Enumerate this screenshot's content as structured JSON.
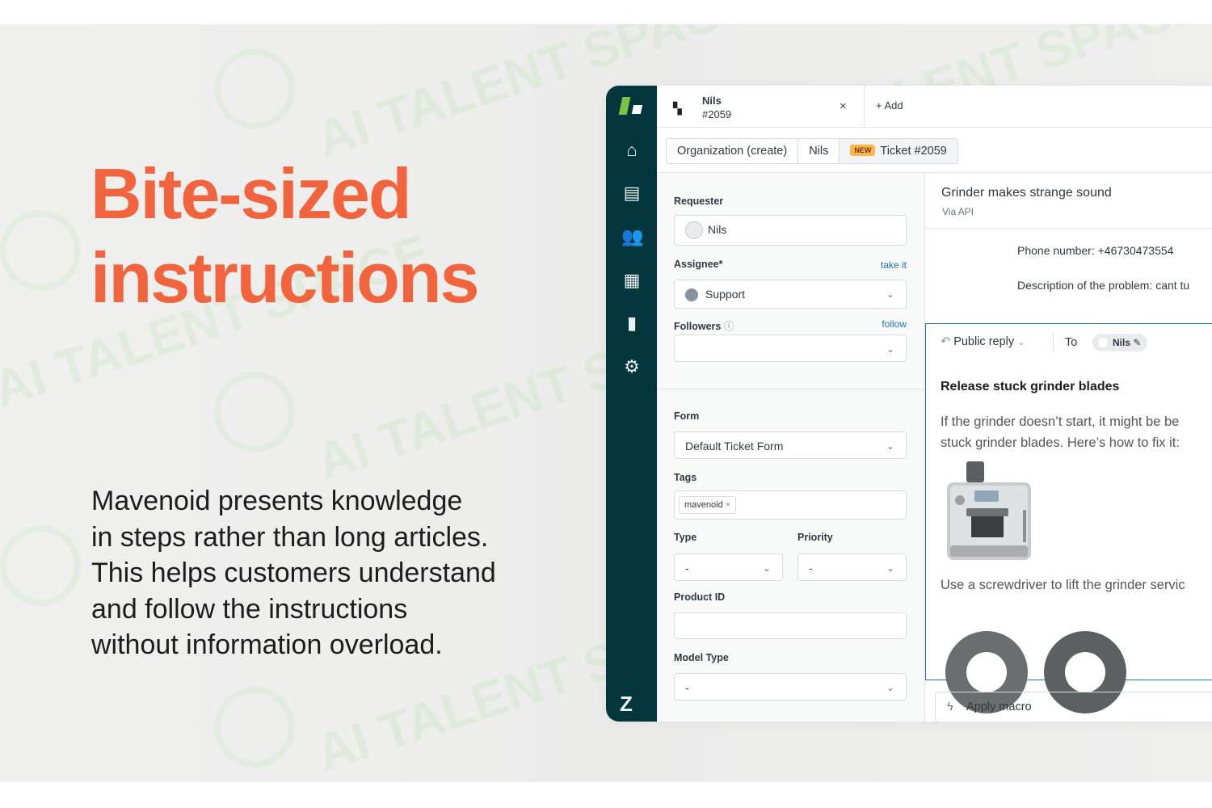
{
  "marketing": {
    "headline_line1": "Bite-sized",
    "headline_line2": "instructions",
    "body_lines": [
      "Mavenoid presents knowledge",
      "in steps rather than long articles.",
      "This helps customers understand",
      "and follow the instructions",
      "without information overload."
    ],
    "watermark": "AI TALENT SPACE"
  },
  "colors": {
    "headline": "#f2643d",
    "rail": "#03363d",
    "link": "#1f73b7",
    "badge_new": "#ffb648"
  },
  "rail": {
    "icons": [
      "zendesk-logo-icon",
      "home-icon",
      "views-icon",
      "customers-icon",
      "organizations-icon",
      "reporting-icon",
      "settings-icon",
      "zendesk-z-icon"
    ]
  },
  "tab": {
    "name": "Nils",
    "number": "#2059",
    "close": "×",
    "add_label": "+ Add"
  },
  "breadcrumbs": {
    "items": [
      "Organization (create)",
      "Nils"
    ],
    "badge": "NEW",
    "ticket": "Ticket #2059"
  },
  "properties": {
    "requester_label": "Requester",
    "requester_value": "Nils",
    "assignee_label": "Assignee*",
    "assignee_link": "take it",
    "assignee_value": "Support",
    "followers_label": "Followers",
    "followers_link": "follow",
    "form_label": "Form",
    "form_value": "Default Ticket Form",
    "tags_label": "Tags",
    "tags": [
      "mavenoid"
    ],
    "type_label": "Type",
    "type_value": "-",
    "priority_label": "Priority",
    "priority_value": "-",
    "product_id_label": "Product ID",
    "model_type_label": "Model Type",
    "model_type_value": "-"
  },
  "conversation": {
    "subject": "Grinder makes strange sound",
    "via": "Via API",
    "phone_line": "Phone number: +46730473554",
    "description_line": "Description of the problem: cant tu"
  },
  "composer": {
    "channel": "Public reply",
    "to_label": "To",
    "recipient": "Nils",
    "heading": "Release stuck grinder blades",
    "para_line1": "If the grinder doesn’t start, it might be be",
    "para_line2": "stuck grinder blades. Here’s how to fix it:",
    "para_line3": "Use a screwdriver to lift the grinder servic"
  },
  "footer": {
    "apply_macro": "Apply macro"
  }
}
